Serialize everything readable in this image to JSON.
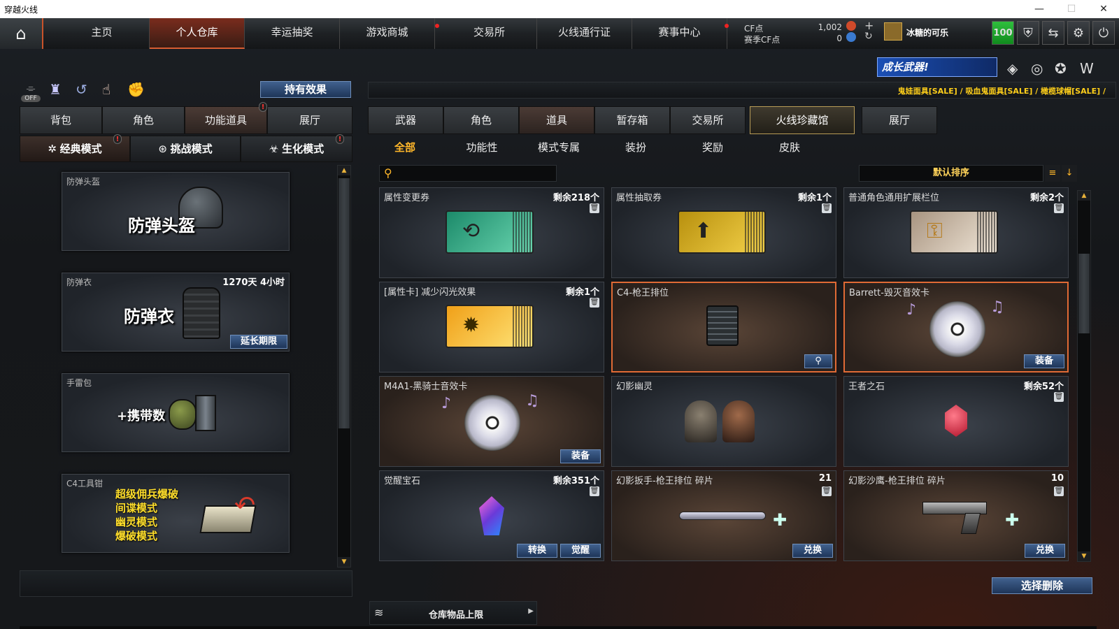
{
  "window": {
    "title": "穿越火线",
    "controls": [
      "—",
      "☐",
      "✕"
    ]
  },
  "nav": {
    "tabs": [
      "主页",
      "个人仓库",
      "幸运抽奖",
      "游戏商城",
      "交易所",
      "火线通行证",
      "赛事中心"
    ],
    "active": "个人仓库",
    "currency": {
      "cf_label": "CF点",
      "cf_value": "1,002",
      "season_label": "赛季CF点",
      "season_value": "0"
    },
    "user": {
      "name": "冰糖的可乐"
    },
    "level_badge": "100"
  },
  "banner": {
    "text": "成长武器!"
  },
  "ticker": {
    "text": "鬼娃面具[SALE] / 吸血鬼面具[SALE] / 橄榄球帽[SALE] /"
  },
  "left": {
    "toggle_label": "OFF",
    "hold_effect_button": "持有效果",
    "tabs": [
      "背包",
      "角色",
      "功能道具",
      "展厅"
    ],
    "modes": [
      "经典模式",
      "挑战模式",
      "生化模式"
    ],
    "items": [
      {
        "name": "防弹头盔",
        "big": "防弹头盔"
      },
      {
        "name": "防弹衣",
        "big": "防弹衣",
        "time": "1270天 4小时",
        "button": "延长期限"
      },
      {
        "name": "手雷包",
        "big": "+携带数"
      },
      {
        "name": "C4工具钳",
        "modes": [
          "超级佣兵爆破",
          "间谍模式",
          "幽灵模式",
          "爆破模式"
        ]
      }
    ]
  },
  "right": {
    "tabs": [
      "武器",
      "角色",
      "道具",
      "暂存箱",
      "交易所",
      "火线珍藏馆",
      "展厅"
    ],
    "subtabs": [
      "全部",
      "功能性",
      "模式专属",
      "装扮",
      "奖励",
      "皮肤"
    ],
    "search_placeholder": "",
    "sort_label": "默认排序",
    "items": [
      {
        "name": "属性变更券",
        "count": "剩余218个"
      },
      {
        "name": "属性抽取券",
        "count": "剩余1个"
      },
      {
        "name": "普通角色通用扩展栏位",
        "count": "剩余2个"
      },
      {
        "name": "[属性卡] 减少闪光效果",
        "count": "剩余1个"
      },
      {
        "name": "C4-枪王排位",
        "count": ""
      },
      {
        "name": "Barrett-毁灭音效卡",
        "count": "",
        "button": "装备"
      },
      {
        "name": "M4A1-黑骑士音效卡",
        "count": "",
        "button": "装备"
      },
      {
        "name": "幻影幽灵",
        "count": ""
      },
      {
        "name": "王者之石",
        "count": "剩余52个"
      },
      {
        "name": "觉醒宝石",
        "count": "剩余351个",
        "buttons": [
          "转换",
          "觉醒"
        ]
      },
      {
        "name": "幻影扳手-枪王排位 碎片",
        "count": "21",
        "button": "兑换"
      },
      {
        "name": "幻影沙鹰-枪王排位 碎片",
        "count": "10",
        "button": "兑换"
      }
    ],
    "delete_button": "选择删除",
    "capacity_label": "仓库物品上限"
  },
  "colors": {
    "accent": "#d85d32",
    "gold": "#ffde2a",
    "tab_active": "#ffb72a",
    "blue_btn": "#2b4a76"
  }
}
